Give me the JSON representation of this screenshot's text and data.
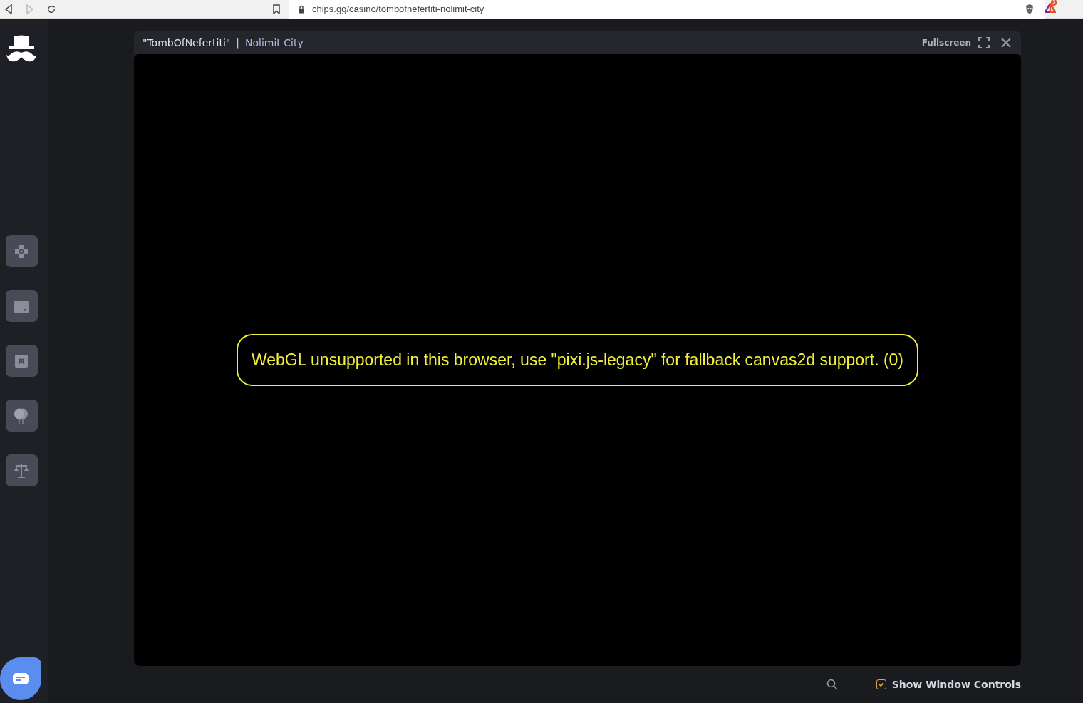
{
  "browser": {
    "url": "chips.gg/casino/tombofnefertiti-nolimit-city",
    "extension_badge": "3"
  },
  "game_window": {
    "title": "\"TombOfNefertiti\"",
    "separator": "|",
    "provider": "Nolimit City",
    "fullscreen_label": "Fullscreen",
    "error_message": "WebGL unsupported in this browser, use \"pixi.js-legacy\" for fallback canvas2d support. (0)"
  },
  "footer": {
    "window_controls": {
      "label": "Show Window Controls",
      "checked": true
    }
  }
}
